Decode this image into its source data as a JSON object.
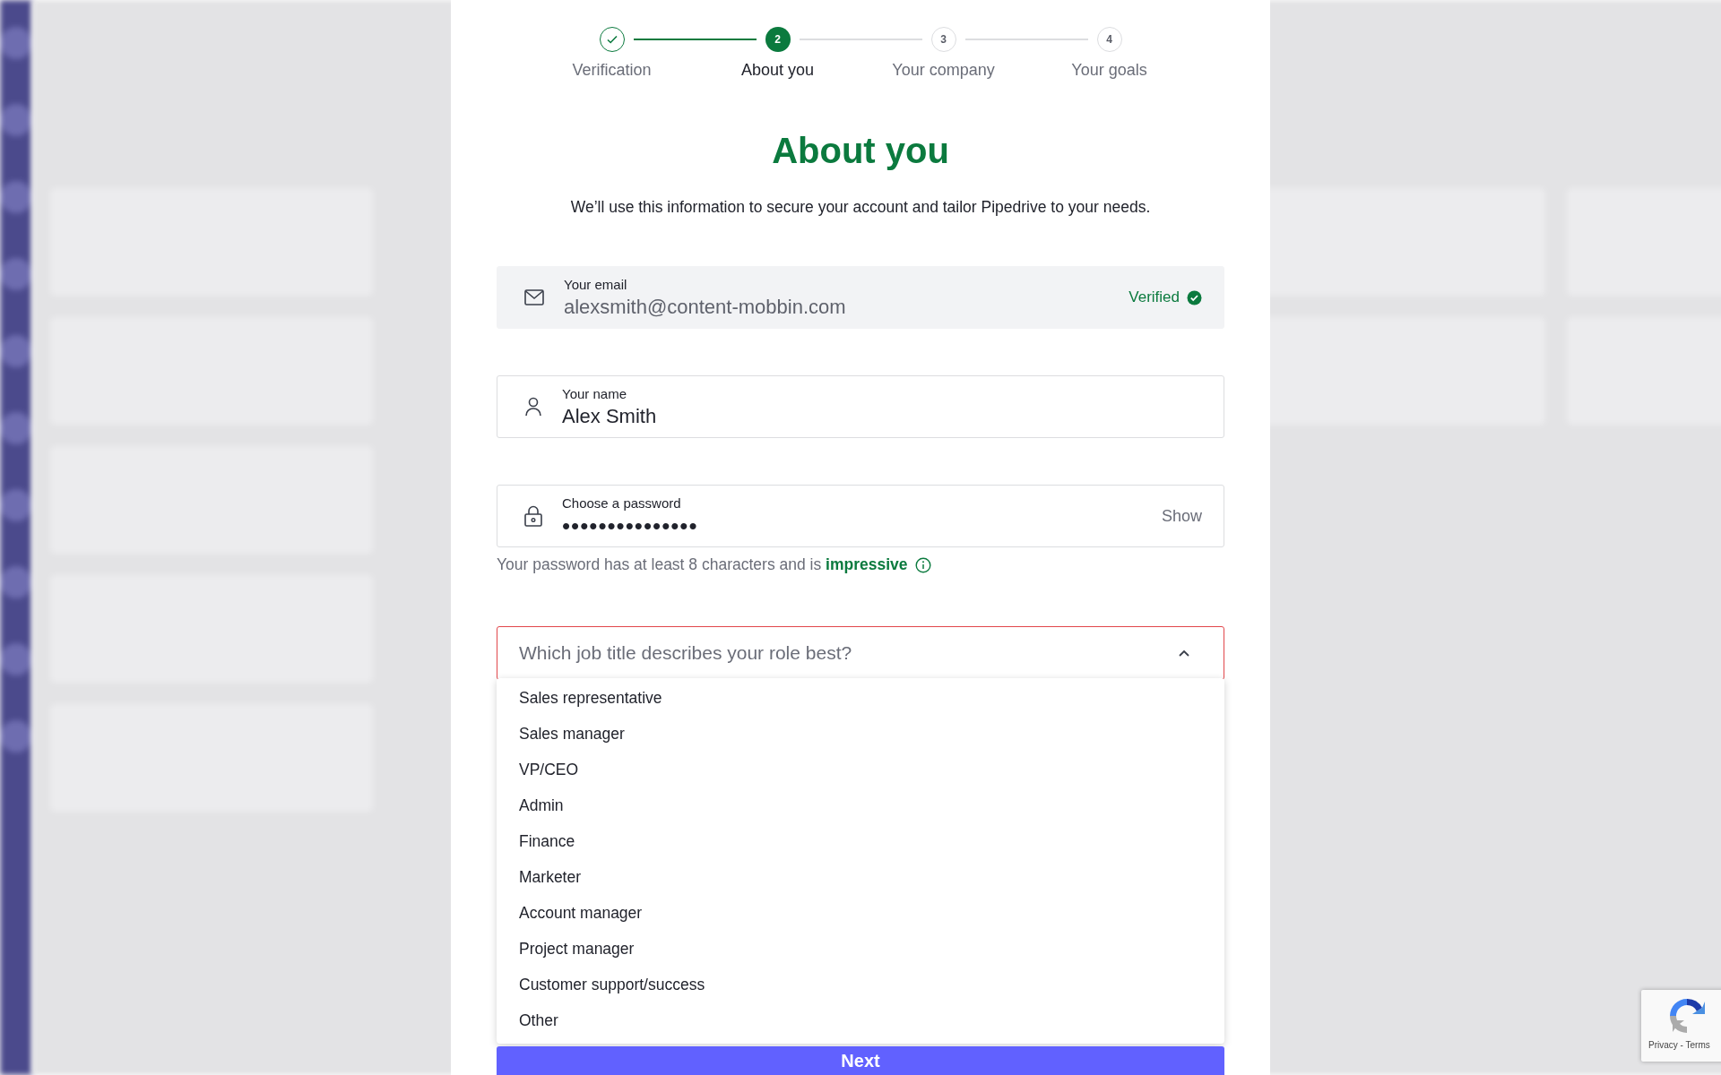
{
  "steps": [
    {
      "kind": "done",
      "label": "Verification"
    },
    {
      "kind": "current",
      "number": "2",
      "label": "About you"
    },
    {
      "kind": "upcoming",
      "number": "3",
      "label": "Your company"
    },
    {
      "kind": "upcoming",
      "number": "4",
      "label": "Your goals"
    }
  ],
  "title": "About you",
  "subtitle": "We’ll use this information to secure your account and tailor Pipedrive to your needs.",
  "fields": [
    {
      "kind": "email",
      "label": "Your email",
      "value": "alexsmith@content-mobbin.com",
      "status": "Verified",
      "disabled": true
    },
    {
      "kind": "name",
      "label": "Your name",
      "value": "Alex Smith",
      "disabled": false
    },
    {
      "kind": "password",
      "label": "Choose a password",
      "value": "•••••••••••••••",
      "action": "Show",
      "disabled": false
    }
  ],
  "password_hint": "Your password has at least 8 characters and is **impressive**",
  "job_select": {
    "placeholder": "Which job title describes your role best?",
    "invalid": true,
    "expanded": true,
    "options": [
      {
        "label": "Sales representative",
        "selected": false
      },
      {
        "label": "Sales manager",
        "selected": false
      },
      {
        "label": "VP/CEO",
        "selected": false
      },
      {
        "label": "Admin",
        "selected": false
      },
      {
        "label": "Finance",
        "selected": false
      },
      {
        "label": "Marketer",
        "selected": false
      },
      {
        "label": "Account manager",
        "selected": false
      },
      {
        "label": "Project manager",
        "selected": false
      },
      {
        "label": "Customer support/success",
        "selected": false
      },
      {
        "label": "Other",
        "selected": false
      }
    ]
  },
  "next_button": "Next",
  "recaptcha": {
    "links": "Privacy - Terms"
  }
}
